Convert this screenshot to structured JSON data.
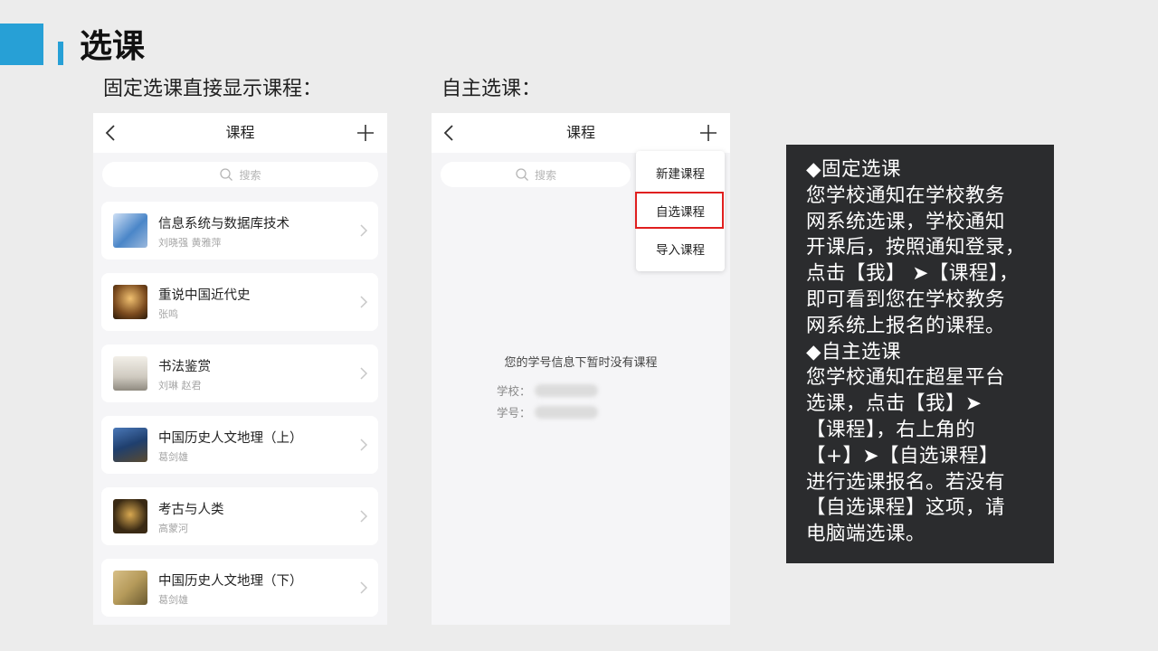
{
  "slide": {
    "title": "选课",
    "caption_left": "固定选课直接显示课程：",
    "caption_right": "自主选课："
  },
  "colors": {
    "accent": "#27a0d6",
    "highlight_border": "#e01f1f",
    "note_bg": "#2b2c2e"
  },
  "phone_left": {
    "header_title": "课程",
    "back_icon": "chevron-left-icon",
    "add_icon": "plus-icon",
    "search_placeholder": "搜索",
    "courses": [
      {
        "name": "信息系统与数据库技术",
        "teacher": "刘晓强 黄雅萍",
        "thumb_color": "#4a86c8"
      },
      {
        "name": "重说中国近代史",
        "teacher": "张鸣",
        "thumb_color": "#7a4a1e"
      },
      {
        "name": "书法鉴赏",
        "teacher": "刘琳 赵君",
        "thumb_color": "#cfcac0"
      },
      {
        "name": "中国历史人文地理（上）",
        "teacher": "葛剑雄",
        "thumb_color": "#1f3f6e"
      },
      {
        "name": "考古与人类",
        "teacher": "高蒙河",
        "thumb_color": "#3a2a14"
      },
      {
        "name": "中国历史人文地理（下）",
        "teacher": "葛剑雄",
        "thumb_color": "#b59a5a"
      }
    ]
  },
  "phone_right": {
    "header_title": "课程",
    "search_placeholder": "搜索",
    "menu": [
      "新建课程",
      "自选课程",
      "导入课程"
    ],
    "empty_message": "您的学号信息下暂时没有课程",
    "school_label": "学校：",
    "student_id_label": "学号："
  },
  "notes": {
    "lines": [
      "◆固定选课",
      "您学校通知在学校教务",
      "网系统选课，学校通知",
      "开课后，按照通知登录，",
      "点击【我】 ➤【课程】，",
      "即可看到您在学校教务",
      "网系统上报名的课程。",
      "◆自主选课",
      "您学校通知在超星平台",
      "选课，点击【我】➤",
      "【课程】，右上角的",
      "【+】➤【自选课程】",
      "进行选课报名。若没有",
      "【自选课程】这项，请",
      "电脑端选课。"
    ]
  }
}
